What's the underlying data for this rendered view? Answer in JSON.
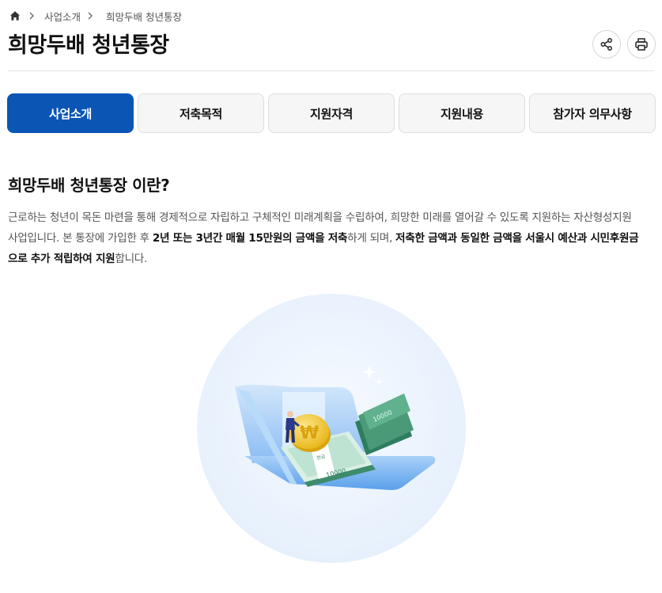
{
  "breadcrumb": {
    "items": [
      "사업소개"
    ],
    "current": "희망두배 청년통장"
  },
  "page": {
    "title": "희망두배 청년통장"
  },
  "tools": {
    "share_icon": "share-icon",
    "print_icon": "print-icon"
  },
  "tabs": [
    {
      "label": "사업소개",
      "active": true
    },
    {
      "label": "저축목적",
      "active": false
    },
    {
      "label": "지원자격",
      "active": false
    },
    {
      "label": "지원내용",
      "active": false
    },
    {
      "label": "참가자 의무사항",
      "active": false
    }
  ],
  "section": {
    "heading": "희망두배 청년통장 이란?",
    "desc": {
      "p1": "근로하는 청년이 목돈 마련을 통해 경제적으로 자립하고 구체적인 미래계획을 수립하여, 희망한 미래를 열어갈 수 있도록 지원하는 자산형성지원사업입니다. 본 통장에 가입한 후 ",
      "b1": "2년 또는 3년간 매월 15만원의 금액을 저축",
      "p2": "하게 되며, ",
      "b2": "저축한 금액과 동일한 금액을 서울시 예산과 시민후원금으로 추가 적립하여 지원",
      "p3": "합니다."
    }
  },
  "illustration": {
    "banknote_front": "10000",
    "banknote_back": "10000",
    "band_text": "현금",
    "coin_symbol": "₩"
  },
  "colors": {
    "accent": "#0b55b5",
    "circle_bg": "#eaf3fd",
    "money_green": "#4a9a78",
    "coin_gold": "#f5c531"
  }
}
